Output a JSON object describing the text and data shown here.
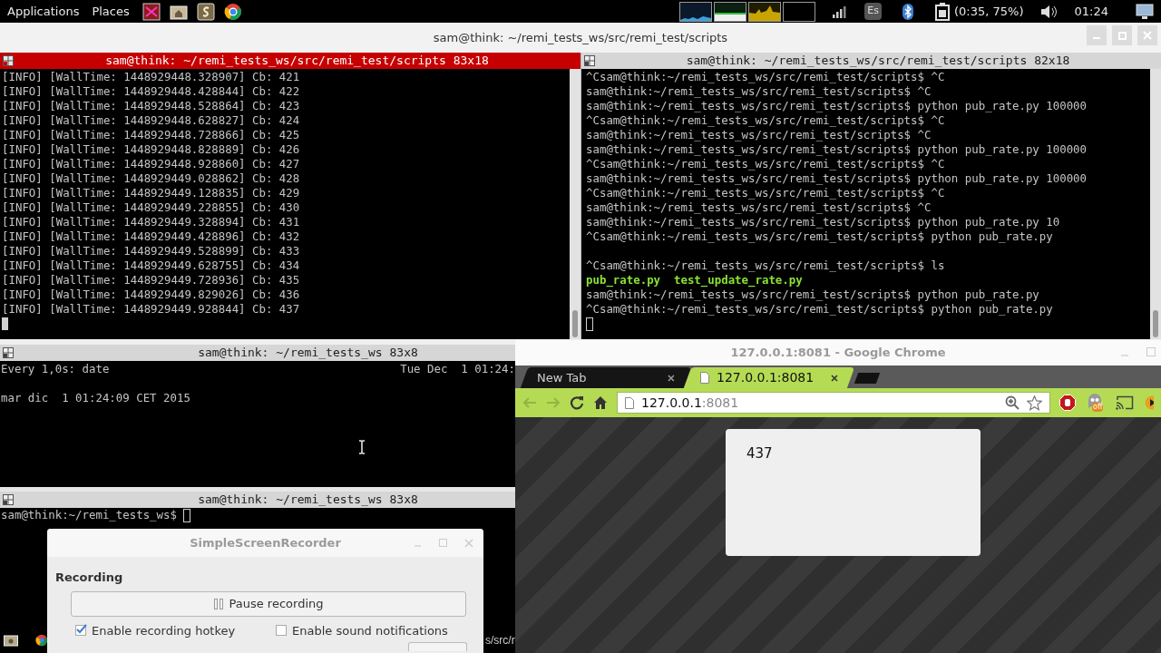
{
  "top_panel": {
    "menus": [
      "Applications",
      "Places"
    ],
    "keyboard_layout": "Es",
    "battery": "(0:35, 75%)",
    "clock": "01:24"
  },
  "terminal_window": {
    "title": "sam@think: ~/remi_tests_ws/src/remi_test/scripts",
    "pane_top_left": {
      "title": "sam@think: ~/remi_tests_ws/src/remi_test/scripts 83x18",
      "focused": true,
      "lines": [
        {
          "kind": "output",
          "text": "[INFO] [WallTime: 1448929448.328907] Cb: 421"
        },
        {
          "kind": "output",
          "text": "[INFO] [WallTime: 1448929448.428844] Cb: 422"
        },
        {
          "kind": "output",
          "text": "[INFO] [WallTime: 1448929448.528864] Cb: 423"
        },
        {
          "kind": "output",
          "text": "[INFO] [WallTime: 1448929448.628827] Cb: 424"
        },
        {
          "kind": "output",
          "text": "[INFO] [WallTime: 1448929448.728866] Cb: 425"
        },
        {
          "kind": "output",
          "text": "[INFO] [WallTime: 1448929448.828889] Cb: 426"
        },
        {
          "kind": "output",
          "text": "[INFO] [WallTime: 1448929448.928860] Cb: 427"
        },
        {
          "kind": "output",
          "text": "[INFO] [WallTime: 1448929449.028862] Cb: 428"
        },
        {
          "kind": "output",
          "text": "[INFO] [WallTime: 1448929449.128835] Cb: 429"
        },
        {
          "kind": "output",
          "text": "[INFO] [WallTime: 1448929449.228855] Cb: 430"
        },
        {
          "kind": "output",
          "text": "[INFO] [WallTime: 1448929449.328894] Cb: 431"
        },
        {
          "kind": "output",
          "text": "[INFO] [WallTime: 1448929449.428896] Cb: 432"
        },
        {
          "kind": "output",
          "text": "[INFO] [WallTime: 1448929449.528899] Cb: 433"
        },
        {
          "kind": "output",
          "text": "[INFO] [WallTime: 1448929449.628755] Cb: 434"
        },
        {
          "kind": "output",
          "text": "[INFO] [WallTime: 1448929449.728936] Cb: 435"
        },
        {
          "kind": "output",
          "text": "[INFO] [WallTime: 1448929449.829026] Cb: 436"
        },
        {
          "kind": "output",
          "text": "[INFO] [WallTime: 1448929449.928844] Cb: 437"
        },
        {
          "kind": "cursor"
        }
      ]
    },
    "pane_top_right": {
      "title": "sam@think: ~/remi_tests_ws/src/remi_test/scripts 82x18",
      "focused": false,
      "lines": [
        {
          "kind": "output",
          "text": "^Csam@think:~/remi_tests_ws/src/remi_test/scripts$ ^C"
        },
        {
          "kind": "output",
          "text": "sam@think:~/remi_tests_ws/src/remi_test/scripts$ ^C"
        },
        {
          "kind": "output",
          "text": "sam@think:~/remi_tests_ws/src/remi_test/scripts$ python pub_rate.py 100000"
        },
        {
          "kind": "output",
          "text": "^Csam@think:~/remi_tests_ws/src/remi_test/scripts$ ^C"
        },
        {
          "kind": "output",
          "text": "sam@think:~/remi_tests_ws/src/remi_test/scripts$ ^C"
        },
        {
          "kind": "output",
          "text": "sam@think:~/remi_tests_ws/src/remi_test/scripts$ python pub_rate.py 100000"
        },
        {
          "kind": "output",
          "text": "^Csam@think:~/remi_tests_ws/src/remi_test/scripts$ ^C"
        },
        {
          "kind": "output",
          "text": "sam@think:~/remi_tests_ws/src/remi_test/scripts$ python pub_rate.py 100000"
        },
        {
          "kind": "output",
          "text": "^Csam@think:~/remi_tests_ws/src/remi_test/scripts$ ^C"
        },
        {
          "kind": "output",
          "text": "sam@think:~/remi_tests_ws/src/remi_test/scripts$ ^C"
        },
        {
          "kind": "output",
          "text": "sam@think:~/remi_tests_ws/src/remi_test/scripts$ python pub_rate.py 10"
        },
        {
          "kind": "output",
          "text": "^Csam@think:~/remi_tests_ws/src/remi_test/scripts$ python pub_rate.py"
        },
        {
          "kind": "blank"
        },
        {
          "kind": "output",
          "text": "^Csam@think:~/remi_tests_ws/src/remi_test/scripts$ ls"
        },
        {
          "kind": "file_list",
          "text": "pub_rate.py  test_update_rate.py"
        },
        {
          "kind": "output",
          "text": "sam@think:~/remi_tests_ws/src/remi_test/scripts$ python pub_rate.py"
        },
        {
          "kind": "output",
          "text": "^Csam@think:~/remi_tests_ws/src/remi_test/scripts$ python pub_rate.py"
        },
        {
          "kind": "hollow_cursor"
        }
      ]
    },
    "pane_bottom_upper": {
      "title": "sam@think: ~/remi_tests_ws 83x8",
      "focused": false,
      "header_left": "Every 1,0s: date",
      "header_right": "Tue Dec  1 01:24:",
      "lines": [
        {
          "kind": "blank"
        },
        {
          "kind": "output",
          "text": "mar dic  1 01:24:09 CET 2015"
        }
      ]
    },
    "pane_bottom_lower": {
      "title": "sam@think: ~/remi_tests_ws 83x8",
      "focused": false,
      "lines": [
        {
          "kind": "prompt",
          "text": "sam@think:~/remi_tests_ws$ "
        }
      ]
    }
  },
  "chrome_window": {
    "title": "127.0.0.1:8081 - Google Chrome",
    "tabs": [
      {
        "label": "New Tab",
        "selected": false
      },
      {
        "label": "127.0.0.1:8081",
        "selected": true
      }
    ],
    "url_host": "127.0.0.1",
    "url_port": ":8081",
    "extension_badge": "off",
    "page_counter": "437"
  },
  "recorder_dialog": {
    "title": "SimpleScreenRecorder",
    "section": "Recording",
    "pause_button": "Pause recording",
    "options": [
      {
        "label": "Enable recording hotkey",
        "checked": true
      },
      {
        "label": "Enable sound notifications",
        "checked": false
      }
    ]
  },
  "bottom_panel": {
    "task_label": "s/src/r"
  }
}
